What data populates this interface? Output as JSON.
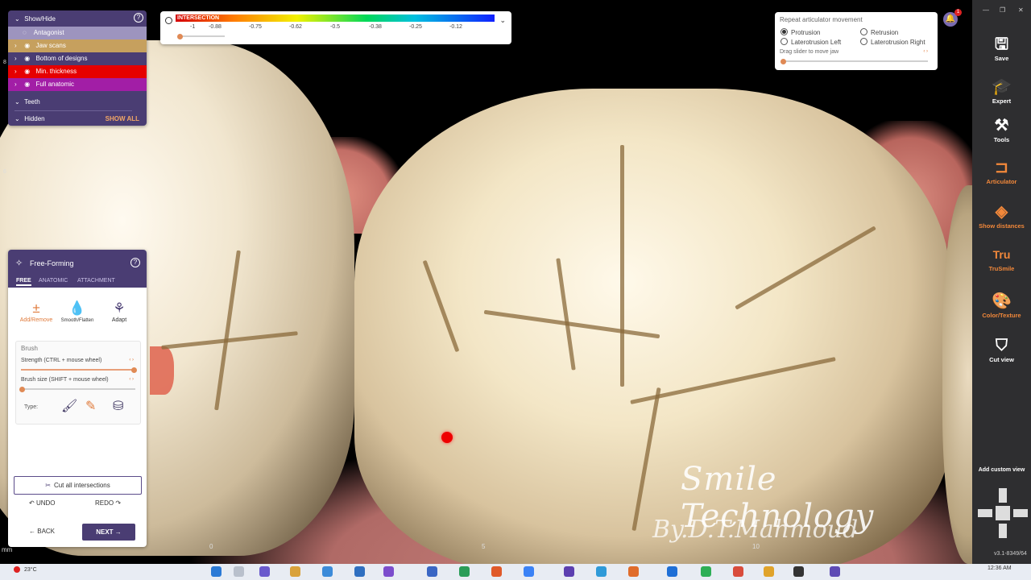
{
  "show_hide": {
    "title": "Show/Hide",
    "rows": [
      {
        "label": "Antagonist",
        "color": "#9d94be"
      },
      {
        "label": "Jaw scans",
        "color": "#c6a05e"
      },
      {
        "label": "Bottom of designs",
        "color": "#4a3d73"
      },
      {
        "label": "Min. thickness",
        "color": "#e60000"
      },
      {
        "label": "Full anatomic",
        "color": "#a21ea6"
      }
    ],
    "teeth_label": "Teeth",
    "hidden_label": "Hidden",
    "show_all_label": "SHOW ALL"
  },
  "intersection": {
    "label": "INTERSECTION",
    "ticks": [
      "-1",
      "-0.88",
      "-0.75",
      "-0.62",
      "-0.5",
      "-0.38",
      "-0.25",
      "-0.12"
    ]
  },
  "articulator": {
    "title": "Repeat articulator movement",
    "options": [
      "Protrusion",
      "Retrusion",
      "Laterotrusion Left",
      "Laterotrusion Right"
    ],
    "selected": "Protrusion",
    "drag_label": "Drag slider to move jaw"
  },
  "notifications": {
    "count": "1"
  },
  "free_forming": {
    "title": "Free-Forming",
    "tabs": [
      "FREE",
      "ANATOMIC",
      "ATTACHMENT"
    ],
    "active_tab": "FREE",
    "tools": [
      {
        "label": "Add/Remove",
        "icon": "add-remove-icon"
      },
      {
        "label": "Smooth/Flatten",
        "icon": "drop-icon"
      },
      {
        "label": "Adapt",
        "icon": "adapt-icon"
      }
    ],
    "brush": {
      "title": "Brush",
      "strength_label": "Strength (CTRL + mouse wheel)",
      "strength_value": 0.95,
      "size_label": "Brush size (SHIFT + mouse wheel)",
      "size_value": 0.0,
      "type_label": "Type:"
    },
    "cut_label": "Cut all intersections",
    "undo_label": "UNDO",
    "redo_label": "REDO",
    "back_label": "BACK",
    "next_label": "NEXT"
  },
  "toolbar": {
    "items": [
      {
        "label": "Save",
        "icon": "save-icon"
      },
      {
        "label": "Expert",
        "icon": "graduation-cap-icon"
      },
      {
        "label": "Tools",
        "icon": "tools-icon"
      },
      {
        "label": "Articulator",
        "icon": "articulator-icon"
      },
      {
        "label": "Show distances",
        "icon": "distances-icon"
      },
      {
        "label": "TruSmile",
        "icon": "trusmile-icon"
      },
      {
        "label": "Color/Texture",
        "icon": "palette-icon"
      },
      {
        "label": "Cut view",
        "icon": "cut-view-icon"
      }
    ],
    "custom_view_label": "Add custom view",
    "version": "v3.1-8349/64"
  },
  "viewport": {
    "watermark_line1": "Smile Technology",
    "watermark_line2": "By.D.T.Mahmoud",
    "ruler_unit": "mm",
    "ruler_bottom": [
      "0",
      "5",
      "10"
    ],
    "ruler_left": [
      "8",
      "6"
    ]
  },
  "taskbar": {
    "weather": "23°C",
    "clock": "12:36 AM"
  }
}
